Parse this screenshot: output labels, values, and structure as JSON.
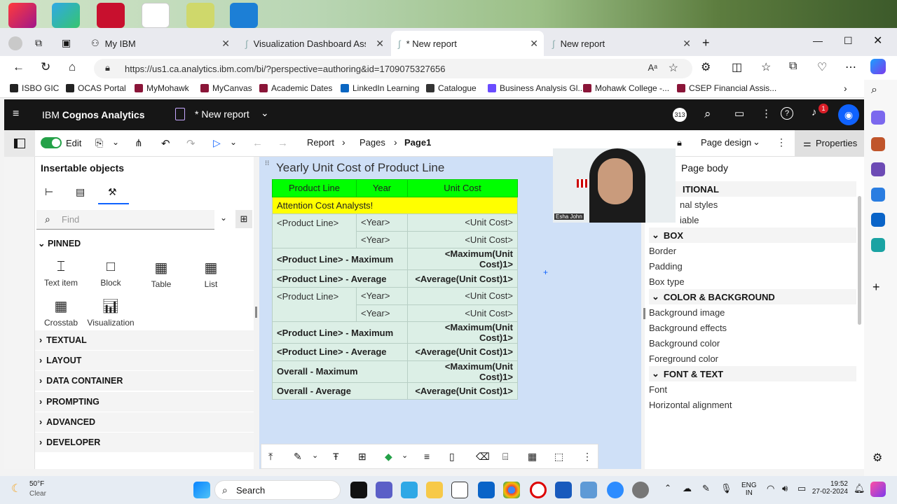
{
  "browser": {
    "tabs": [
      {
        "label": "My IBM"
      },
      {
        "label": "Visualization Dashboard Assignm"
      },
      {
        "label": "* New report"
      },
      {
        "label": "New report"
      }
    ],
    "url": "https://us1.ca.analytics.ibm.com/bi/?perspective=authoring&id=1709075327656",
    "bookmarks": [
      {
        "label": "ISBO GIC",
        "color": "#222"
      },
      {
        "label": "OCAS Portal",
        "color": "#222"
      },
      {
        "label": "MyMohawk",
        "color": "#8a1538"
      },
      {
        "label": "MyCanvas",
        "color": "#8a1538"
      },
      {
        "label": "Academic Dates",
        "color": "#8a1538"
      },
      {
        "label": "LinkedIn Learning",
        "color": "#0a66c2"
      },
      {
        "label": "Catalogue",
        "color": "#333"
      },
      {
        "label": "Business Analysis Gl...",
        "color": "#6a4cff"
      },
      {
        "label": "Mohawk College -...",
        "color": "#8a1538"
      },
      {
        "label": "CSEP Financial Assis...",
        "color": "#8a1538"
      }
    ]
  },
  "cognos": {
    "brand_prefix": "IBM ",
    "brand_name": "Cognos Analytics",
    "doc_title": "* New report",
    "badge": "313",
    "notif_count": "1",
    "toolbar": {
      "edit_label": "Edit",
      "crumbs": [
        "Report",
        "Pages",
        "Page1"
      ],
      "page_design": "Page design",
      "properties": "Properties"
    }
  },
  "left_panel": {
    "title": "Insertable objects",
    "find_placeholder": "Find",
    "pinned": "PINNED",
    "objects": [
      {
        "label": "Text item",
        "icon": "text-item-icon"
      },
      {
        "label": "Block",
        "icon": "block-icon"
      },
      {
        "label": "Table",
        "icon": "table-icon"
      },
      {
        "label": "List",
        "icon": "list-icon"
      },
      {
        "label": "Crosstab",
        "icon": "crosstab-icon"
      },
      {
        "label": "Visualization",
        "icon": "visualization-icon"
      }
    ],
    "sections": [
      "TEXTUAL",
      "LAYOUT",
      "DATA CONTAINER",
      "PROMPTING",
      "ADVANCED",
      "DEVELOPER"
    ]
  },
  "report": {
    "title": "Yearly Unit Cost of Product Line",
    "headers": [
      "Product Line",
      "Year",
      "Unit Cost"
    ],
    "attention": "Attention Cost Analysts!",
    "rows": [
      [
        "<Product Line>",
        "<Year>",
        "<Unit Cost>"
      ],
      [
        "",
        "<Year>",
        "<Unit Cost>"
      ],
      [
        "<Product Line>  -  Maximum",
        "",
        "<Maximum(Unit Cost)1>"
      ],
      [
        "<Product Line>  -  Average",
        "",
        "<Average(Unit Cost)1>"
      ],
      [
        "<Product Line>",
        "<Year>",
        "<Unit Cost>"
      ],
      [
        "",
        "<Year>",
        "<Unit Cost>"
      ],
      [
        "<Product Line>  -  Maximum",
        "",
        "<Maximum(Unit Cost)1>"
      ],
      [
        "<Product Line>  -  Average",
        "",
        "<Average(Unit Cost)1>"
      ],
      [
        "Overall  -  Maximum",
        "",
        "<Maximum(Unit Cost)1>"
      ],
      [
        "Overall  -  Average",
        "",
        "<Average(Unit Cost)1>"
      ]
    ]
  },
  "right_panel": {
    "title": "Page body",
    "conditional": "ITIONAL",
    "cond_items": [
      "nal styles",
      "iable"
    ],
    "box": "BOX",
    "box_items": [
      "Border",
      "Padding",
      "Box type"
    ],
    "color_bg": "COLOR & BACKGROUND",
    "color_items": [
      "Background image",
      "Background effects",
      "Background color",
      "Foreground color"
    ],
    "font_text": "FONT & TEXT",
    "font_items": [
      "Font",
      "Horizontal alignment"
    ]
  },
  "webcam": {
    "name": "Esha John"
  },
  "taskbar": {
    "weather_temp": "50°F",
    "weather_desc": "Clear",
    "search": "Search",
    "lang1": "ENG",
    "lang2": "IN",
    "time": "19:52",
    "date": "27-02-2024"
  },
  "colors": {
    "header_green": "#00ff00",
    "attention_yellow": "#ffff00",
    "canvas_blue": "#cfe0f7",
    "cognos_dark": "#161616",
    "accent_blue": "#0f62fe"
  }
}
